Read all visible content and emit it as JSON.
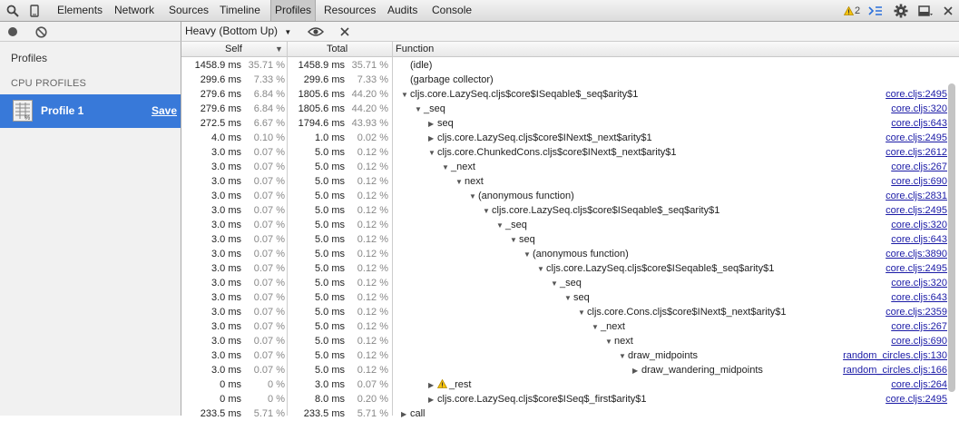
{
  "toolbar": {
    "tabs": [
      "Elements",
      "Network",
      "Sources",
      "Timeline",
      "Profiles",
      "Resources",
      "Audits",
      "Console"
    ],
    "active_tab": "Profiles",
    "warning_count": "2"
  },
  "sidebar": {
    "profiles_label": "Profiles",
    "section_label": "CPU PROFILES",
    "profile_name": "Profile 1",
    "save_label": "Save"
  },
  "subbar": {
    "view_select": "Heavy (Bottom Up)"
  },
  "columns": {
    "self": "Self",
    "total": "Total",
    "function": "Function"
  },
  "rows": [
    {
      "self": "1458.9 ms",
      "self_pct": "35.71 %",
      "total": "1458.9 ms",
      "total_pct": "35.71 %",
      "depth": 0,
      "tri": "",
      "warn": false,
      "name": "(idle)",
      "url": ""
    },
    {
      "self": "299.6 ms",
      "self_pct": "7.33 %",
      "total": "299.6 ms",
      "total_pct": "7.33 %",
      "depth": 0,
      "tri": "",
      "warn": false,
      "name": "(garbage collector)",
      "url": ""
    },
    {
      "self": "279.6 ms",
      "self_pct": "6.84 %",
      "total": "1805.6 ms",
      "total_pct": "44.20 %",
      "depth": 0,
      "tri": "down",
      "warn": false,
      "name": "cljs.core.LazySeq.cljs$core$ISeqable$_seq$arity$1",
      "url": "core.cljs:2495"
    },
    {
      "self": "279.6 ms",
      "self_pct": "6.84 %",
      "total": "1805.6 ms",
      "total_pct": "44.20 %",
      "depth": 1,
      "tri": "down",
      "warn": false,
      "name": "_seq",
      "url": "core.cljs:320"
    },
    {
      "self": "272.5 ms",
      "self_pct": "6.67 %",
      "total": "1794.6 ms",
      "total_pct": "43.93 %",
      "depth": 2,
      "tri": "right",
      "warn": false,
      "name": "seq",
      "url": "core.cljs:643"
    },
    {
      "self": "4.0 ms",
      "self_pct": "0.10 %",
      "total": "1.0 ms",
      "total_pct": "0.02 %",
      "depth": 2,
      "tri": "right",
      "warn": false,
      "name": "cljs.core.LazySeq.cljs$core$INext$_next$arity$1",
      "url": "core.cljs:2495"
    },
    {
      "self": "3.0 ms",
      "self_pct": "0.07 %",
      "total": "5.0 ms",
      "total_pct": "0.12 %",
      "depth": 2,
      "tri": "down",
      "warn": false,
      "name": "cljs.core.ChunkedCons.cljs$core$INext$_next$arity$1",
      "url": "core.cljs:2612"
    },
    {
      "self": "3.0 ms",
      "self_pct": "0.07 %",
      "total": "5.0 ms",
      "total_pct": "0.12 %",
      "depth": 3,
      "tri": "down",
      "warn": false,
      "name": "_next",
      "url": "core.cljs:267"
    },
    {
      "self": "3.0 ms",
      "self_pct": "0.07 %",
      "total": "5.0 ms",
      "total_pct": "0.12 %",
      "depth": 4,
      "tri": "down",
      "warn": false,
      "name": "next",
      "url": "core.cljs:690"
    },
    {
      "self": "3.0 ms",
      "self_pct": "0.07 %",
      "total": "5.0 ms",
      "total_pct": "0.12 %",
      "depth": 5,
      "tri": "down",
      "warn": false,
      "name": "(anonymous function)",
      "url": "core.cljs:2831"
    },
    {
      "self": "3.0 ms",
      "self_pct": "0.07 %",
      "total": "5.0 ms",
      "total_pct": "0.12 %",
      "depth": 6,
      "tri": "down",
      "warn": false,
      "name": "cljs.core.LazySeq.cljs$core$ISeqable$_seq$arity$1",
      "url": "core.cljs:2495"
    },
    {
      "self": "3.0 ms",
      "self_pct": "0.07 %",
      "total": "5.0 ms",
      "total_pct": "0.12 %",
      "depth": 7,
      "tri": "down",
      "warn": false,
      "name": "_seq",
      "url": "core.cljs:320"
    },
    {
      "self": "3.0 ms",
      "self_pct": "0.07 %",
      "total": "5.0 ms",
      "total_pct": "0.12 %",
      "depth": 8,
      "tri": "down",
      "warn": false,
      "name": "seq",
      "url": "core.cljs:643"
    },
    {
      "self": "3.0 ms",
      "self_pct": "0.07 %",
      "total": "5.0 ms",
      "total_pct": "0.12 %",
      "depth": 9,
      "tri": "down",
      "warn": false,
      "name": "(anonymous function)",
      "url": "core.cljs:3890"
    },
    {
      "self": "3.0 ms",
      "self_pct": "0.07 %",
      "total": "5.0 ms",
      "total_pct": "0.12 %",
      "depth": 10,
      "tri": "down",
      "warn": false,
      "name": "cljs.core.LazySeq.cljs$core$ISeqable$_seq$arity$1",
      "url": "core.cljs:2495"
    },
    {
      "self": "3.0 ms",
      "self_pct": "0.07 %",
      "total": "5.0 ms",
      "total_pct": "0.12 %",
      "depth": 11,
      "tri": "down",
      "warn": false,
      "name": "_seq",
      "url": "core.cljs:320"
    },
    {
      "self": "3.0 ms",
      "self_pct": "0.07 %",
      "total": "5.0 ms",
      "total_pct": "0.12 %",
      "depth": 12,
      "tri": "down",
      "warn": false,
      "name": "seq",
      "url": "core.cljs:643"
    },
    {
      "self": "3.0 ms",
      "self_pct": "0.07 %",
      "total": "5.0 ms",
      "total_pct": "0.12 %",
      "depth": 13,
      "tri": "down",
      "warn": false,
      "name": "cljs.core.Cons.cljs$core$INext$_next$arity$1",
      "url": "core.cljs:2359"
    },
    {
      "self": "3.0 ms",
      "self_pct": "0.07 %",
      "total": "5.0 ms",
      "total_pct": "0.12 %",
      "depth": 14,
      "tri": "down",
      "warn": false,
      "name": "_next",
      "url": "core.cljs:267"
    },
    {
      "self": "3.0 ms",
      "self_pct": "0.07 %",
      "total": "5.0 ms",
      "total_pct": "0.12 %",
      "depth": 15,
      "tri": "down",
      "warn": false,
      "name": "next",
      "url": "core.cljs:690"
    },
    {
      "self": "3.0 ms",
      "self_pct": "0.07 %",
      "total": "5.0 ms",
      "total_pct": "0.12 %",
      "depth": 16,
      "tri": "down",
      "warn": false,
      "name": "draw_midpoints",
      "url": "random_circles.cljs:130"
    },
    {
      "self": "3.0 ms",
      "self_pct": "0.07 %",
      "total": "5.0 ms",
      "total_pct": "0.12 %",
      "depth": 17,
      "tri": "right",
      "warn": false,
      "name": "draw_wandering_midpoints",
      "url": "random_circles.cljs:166"
    },
    {
      "self": "0 ms",
      "self_pct": "0 %",
      "total": "3.0 ms",
      "total_pct": "0.07 %",
      "depth": 2,
      "tri": "right",
      "warn": true,
      "name": "_rest",
      "url": "core.cljs:264"
    },
    {
      "self": "0 ms",
      "self_pct": "0 %",
      "total": "8.0 ms",
      "total_pct": "0.20 %",
      "depth": 2,
      "tri": "right",
      "warn": false,
      "name": "cljs.core.LazySeq.cljs$core$ISeq$_first$arity$1",
      "url": "core.cljs:2495"
    },
    {
      "self": "233.5 ms",
      "self_pct": "5.71 %",
      "total": "233.5 ms",
      "total_pct": "5.71 %",
      "depth": 0,
      "tri": "right",
      "warn": false,
      "name": "call",
      "url": ""
    }
  ]
}
